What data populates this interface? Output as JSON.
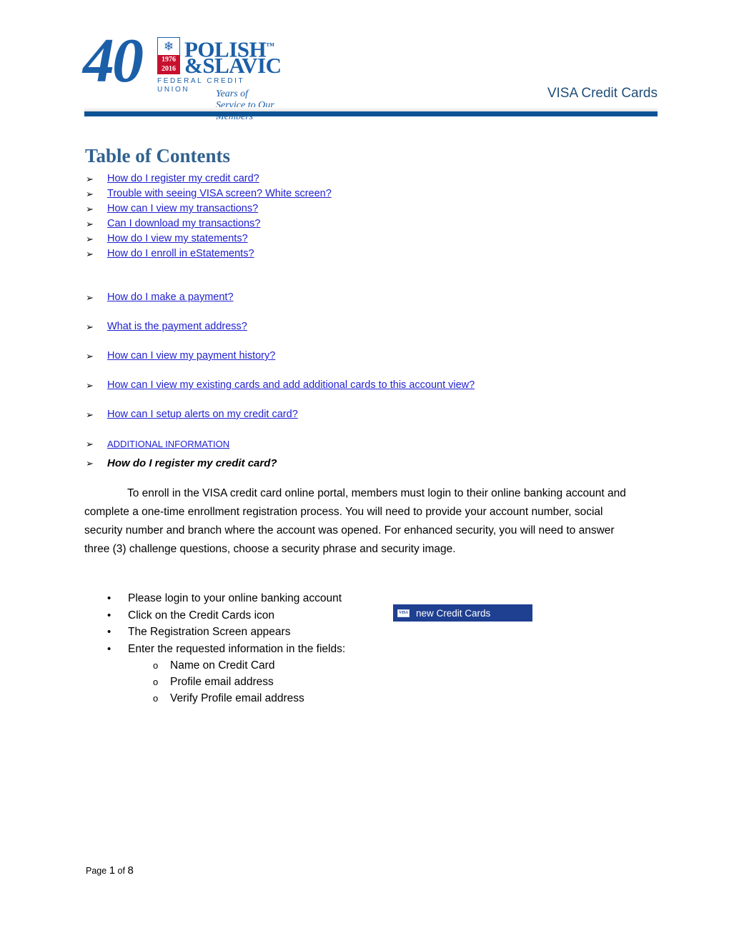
{
  "header": {
    "logo": {
      "anniversary": "40",
      "emblem_icon": "maple-leaf-emblem",
      "year_from": "1976",
      "year_to": "2016",
      "brand_line1": "POLISH",
      "brand_tm": "™",
      "brand_line2": "&SLAVIC",
      "brand_sub": "FEDERAL CREDIT UNION",
      "tagline": "Years of Service to Our Members"
    },
    "title": "VISA Credit Cards",
    "rule_color": "#0b5394",
    "title_color": "#1f4e79"
  },
  "toc": {
    "heading": "Table of Contents",
    "heading_color": "#31618f",
    "link_color": "#1f1fd0",
    "bullet_glyph": "➢",
    "items": [
      {
        "label": "How do I register my credit card?",
        "spaced": false,
        "small": false
      },
      {
        "label": "Trouble with seeing VISA screen? White screen?",
        "spaced": false,
        "small": false
      },
      {
        "label": "How can I view my transactions?",
        "spaced": false,
        "small": false
      },
      {
        "label": "Can I download my transactions?",
        "spaced": false,
        "small": false
      },
      {
        "label": "How do I view my statements?",
        "spaced": false,
        "small": false
      },
      {
        "label": "How do I enroll in eStatements?",
        "spaced": false,
        "small": false
      },
      {
        "label": "How do I make a payment?",
        "spaced": true,
        "small": false
      },
      {
        "label": "What is the payment address?",
        "spaced": true,
        "small": false
      },
      {
        "label": "How can I view my payment history?",
        "spaced": true,
        "small": false
      },
      {
        "label": "How can I view my existing cards and add additional cards to this account view?",
        "spaced": true,
        "small": false
      },
      {
        "label": "How can I setup alerts on my credit card?",
        "spaced": true,
        "small": false
      },
      {
        "label": "ADDITIONAL INFORMATION",
        "spaced": true,
        "small": true
      }
    ]
  },
  "section": {
    "bullet_glyph": "➢",
    "heading": "How do I register my credit card?",
    "paragraph": "To enroll in the VISA credit card online portal, members must login to their online banking account and complete a one-time enrollment registration process. You will need to provide your account number, social security number and branch where the account was opened. For enhanced security, you will need to answer three (3) challenge questions, choose a security phrase and security image.",
    "bullet_dot": "•",
    "sub_bullet_dot": "o",
    "steps": [
      "Please login to your online banking account",
      "Click on the Credit Cards icon",
      "The Registration Screen appears",
      "Enter the requested information in the fields:"
    ],
    "fields": [
      "Name on Credit Card",
      "Profile email address",
      "Verify Profile email address"
    ]
  },
  "credit_cards_button": {
    "icon": "visa-card-icon",
    "icon_label": "VISA",
    "label": "new Credit Cards",
    "background": "#1f3f91"
  },
  "footer": {
    "prefix": "Page",
    "page": "1",
    "middle": "of",
    "total": "8"
  }
}
